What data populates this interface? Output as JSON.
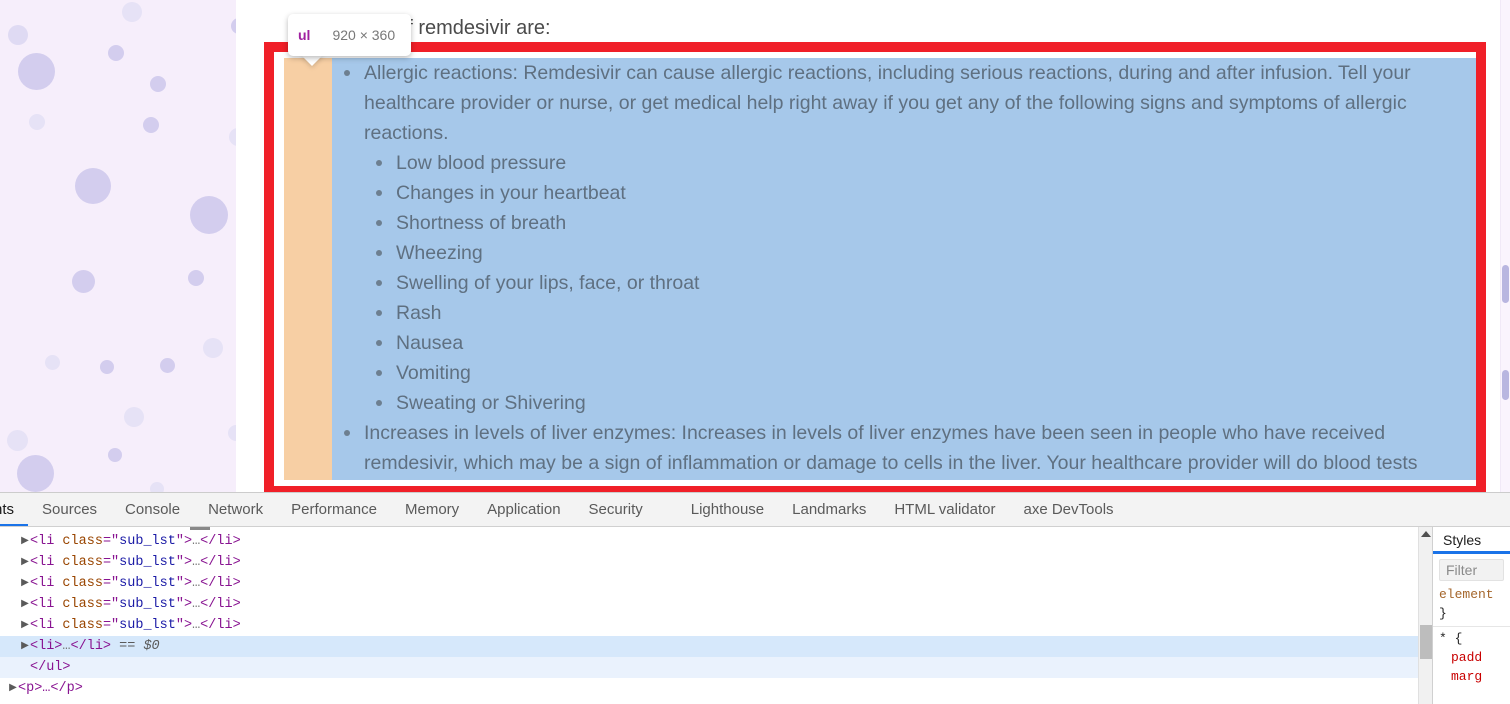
{
  "page": {
    "lead_text": "effects of remdesivir are:",
    "decor": {
      "background": "#f6eefb",
      "bubble_color": "#d3cdee"
    },
    "highlight": {
      "padding_color": "#f7cfa4",
      "content_color": "#a6c8ea",
      "selection_border_color": "#f01f28",
      "text_color": "#5f7081"
    },
    "tooltip": {
      "tag": "ul",
      "dimensions": "920 × 360"
    },
    "list": {
      "items": [
        {
          "text": "Allergic reactions: Remdesivir can cause allergic reactions, including serious reactions, during and after infusion. Tell your healthcare provider or nurse, or get medical help right away if you get any of the following signs and symptoms of allergic reactions.",
          "sub_items": [
            "Low blood pressure",
            "Changes in your heartbeat",
            "Shortness of breath",
            "Wheezing",
            "Swelling of your lips, face, or throat",
            "Rash",
            "Nausea",
            "Vomiting",
            "Sweating or Shivering"
          ]
        },
        {
          "text": "Increases in levels of liver enzymes: Increases in levels of liver enzymes have been seen in people who have received remdesivir, which may be a sign of inflammation or damage to cells in the liver. Your healthcare provider will do blood tests",
          "sub_items": []
        }
      ]
    }
  },
  "devtools": {
    "tabs": [
      {
        "label": "nts",
        "active": true
      },
      {
        "label": "Sources",
        "active": false
      },
      {
        "label": "Console",
        "active": false
      },
      {
        "label": "Network",
        "active": false
      },
      {
        "label": "Performance",
        "active": false
      },
      {
        "label": "Memory",
        "active": false
      },
      {
        "label": "Application",
        "active": false
      },
      {
        "label": "Security",
        "active": false
      },
      {
        "label": "Lighthouse",
        "active": false
      },
      {
        "label": "Landmarks",
        "active": false
      },
      {
        "label": "HTML validator",
        "active": false
      },
      {
        "label": "axe DevTools",
        "active": false
      }
    ],
    "dom_rows": [
      {
        "twisty": "▶",
        "tag": "li",
        "attr_name": "class",
        "attr_value": "sub_lst",
        "selected": false
      },
      {
        "twisty": "▶",
        "tag": "li",
        "attr_name": "class",
        "attr_value": "sub_lst",
        "selected": false
      },
      {
        "twisty": "▶",
        "tag": "li",
        "attr_name": "class",
        "attr_value": "sub_lst",
        "selected": false
      },
      {
        "twisty": "▶",
        "tag": "li",
        "attr_name": "class",
        "attr_value": "sub_lst",
        "selected": false
      },
      {
        "twisty": "▶",
        "tag": "li",
        "attr_name": "class",
        "attr_value": "sub_lst",
        "selected": false
      }
    ],
    "selected_row": {
      "twisty": "▶",
      "open": "<li>",
      "ellipsis": "…",
      "close": "</li>",
      "badge": "== $0"
    },
    "closing_ul": "</ul>",
    "paragraph_row": {
      "twisty": "▶",
      "text": "<p>…</p>"
    },
    "styles": {
      "tab_label": "Styles",
      "filter_placeholder": "Filter",
      "rules": [
        {
          "selector": "element",
          "brace": "}"
        },
        {
          "selector": "*",
          "open_brace": "{",
          "props": [
            "padd",
            "marg"
          ]
        }
      ]
    }
  }
}
